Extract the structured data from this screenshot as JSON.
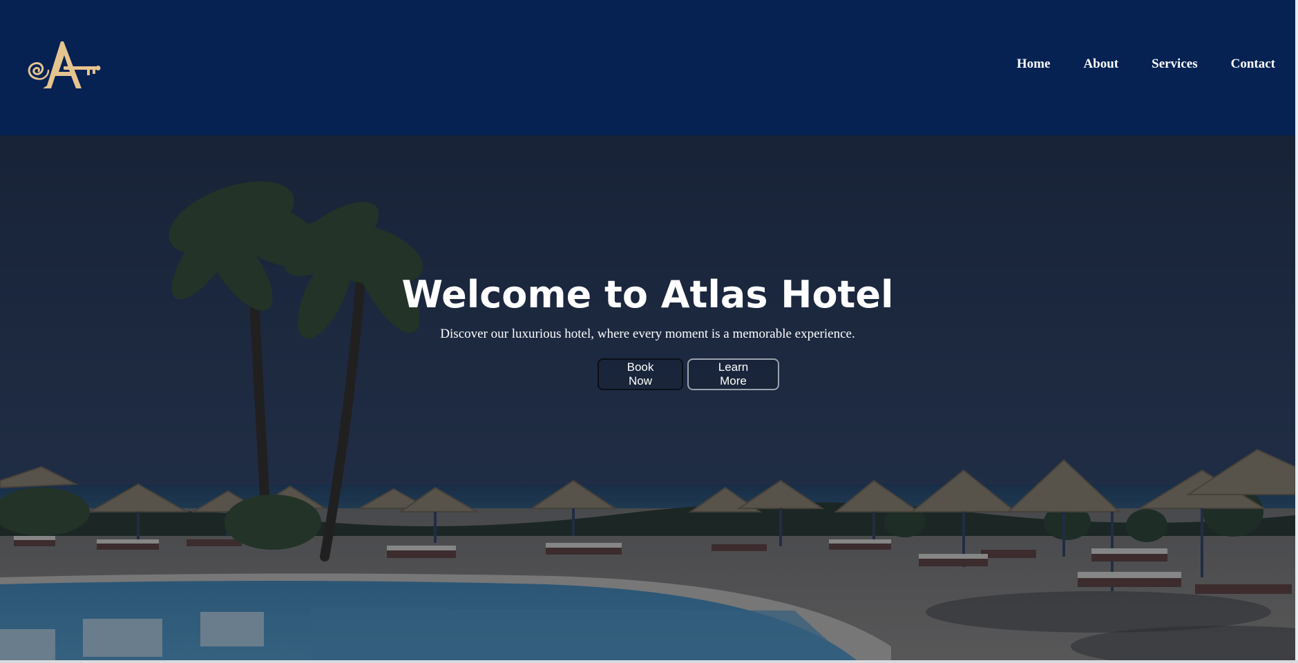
{
  "colors": {
    "header_bg": "#052253",
    "logo_gold": "#e6c48f",
    "text": "#ffffff",
    "overlay": "rgba(20,28,45,0.42)"
  },
  "header": {
    "logo_icon": "atlas-key-logo",
    "nav": [
      "Home",
      "About",
      "Services",
      "Contact"
    ]
  },
  "hero": {
    "title": "Welcome to Atlas Hotel",
    "subtitle": "Discover our luxurious hotel, where every moment is a memorable experience.",
    "buttons": {
      "book_now": "Book Now",
      "learn_more": "Learn More"
    },
    "background": "resort-pool-beach-image"
  }
}
